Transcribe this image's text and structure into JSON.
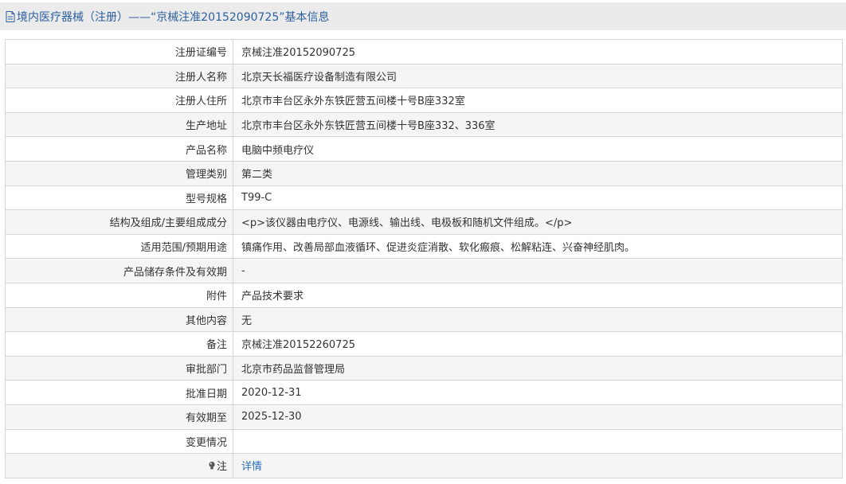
{
  "header": {
    "title": "境内医疗器械（注册）——“京械注准20152090725”基本信息",
    "icon": "document-icon"
  },
  "rows": [
    {
      "label": "注册证编号",
      "value": "京械注准20152090725"
    },
    {
      "label": "注册人名称",
      "value": "北京天长福医疗设备制造有限公司"
    },
    {
      "label": "注册人住所",
      "value": "北京市丰台区永外东铁匠营五间楼十号B座332室"
    },
    {
      "label": "生产地址",
      "value": "北京市丰台区永外东铁匠营五间楼十号B座332、336室"
    },
    {
      "label": "产品名称",
      "value": "电脑中频电疗仪"
    },
    {
      "label": "管理类别",
      "value": "第二类"
    },
    {
      "label": "型号规格",
      "value": "T99-C"
    },
    {
      "label": "结构及组成/主要组成成分",
      "value": "<p>该仪器由电疗仪、电源线、输出线、电极板和随机文件组成。</p>"
    },
    {
      "label": "适用范围/预期用途",
      "value": "镇痛作用、改善局部血液循环、促进炎症消散、软化瘢痕、松解粘连、兴奋神经肌肉。"
    },
    {
      "label": "产品储存条件及有效期",
      "value": "-"
    },
    {
      "label": "附件",
      "value": "产品技术要求"
    },
    {
      "label": "其他内容",
      "value": "无"
    },
    {
      "label": "备注",
      "value": "京械注准20152260725"
    },
    {
      "label": "审批部门",
      "value": "北京市药品监督管理局"
    },
    {
      "label": "批准日期",
      "value": "2020-12-31"
    },
    {
      "label": "有效期至",
      "value": "2025-12-30"
    },
    {
      "label": "变更情况",
      "value": ""
    }
  ],
  "note": {
    "label": "注",
    "icon": "lightbulb-icon",
    "link_text": "详情"
  },
  "colors": {
    "header_bg": "#ebebeb",
    "header_text": "#2c5f9e",
    "link": "#2c6fbf",
    "border": "#d4d4d4",
    "row_alt": "#f5f5f5"
  }
}
